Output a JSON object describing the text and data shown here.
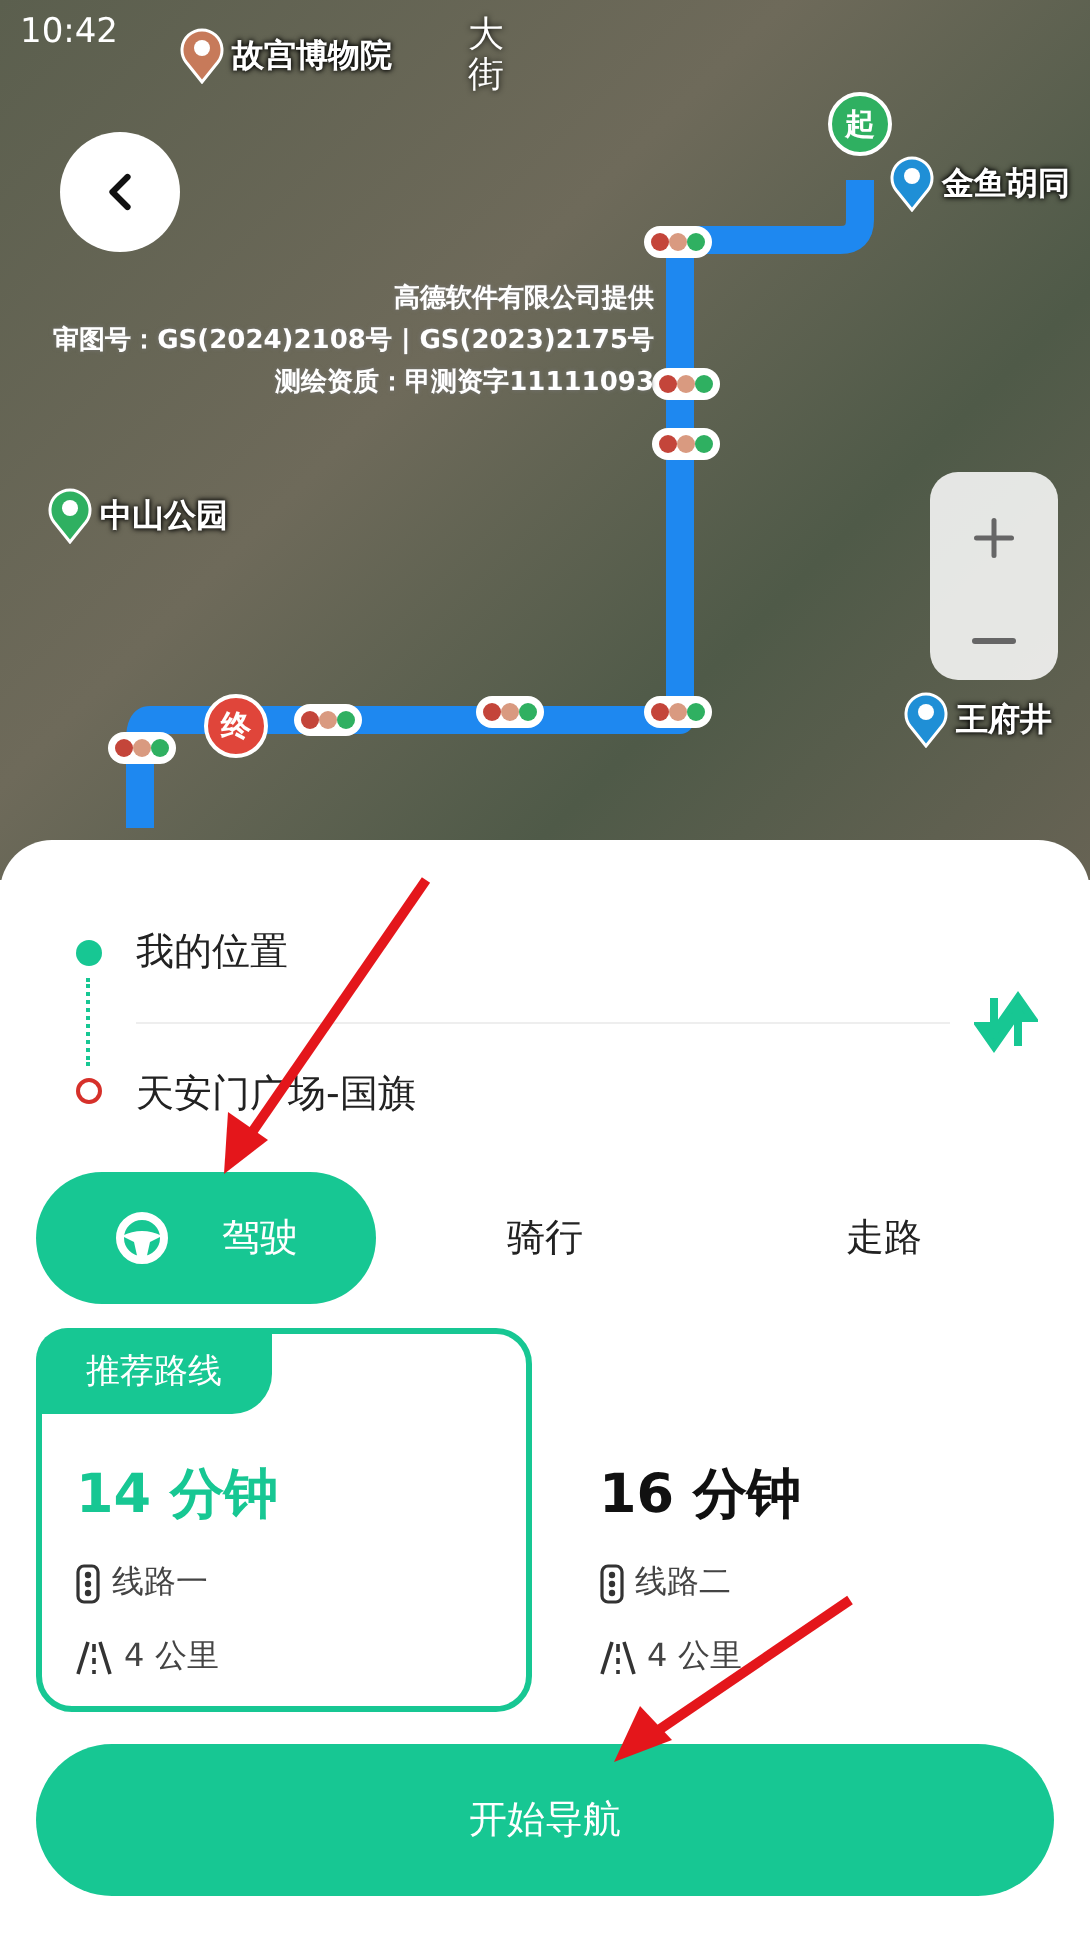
{
  "status_bar": {
    "time": "10:42"
  },
  "map": {
    "labels": [
      {
        "text": "故宫博物院",
        "kind": "poi"
      },
      {
        "text": "大街",
        "kind": "road"
      },
      {
        "text": "金鱼胡同",
        "kind": "metro"
      },
      {
        "text": "中山公园",
        "kind": "park"
      },
      {
        "text": "王府井",
        "kind": "metro"
      }
    ],
    "copyright": [
      "高德软件有限公司提供",
      "审图号：GS(2024)2108号 | GS(2023)2175号",
      "测绘资质：甲测资字11111093"
    ],
    "start_marker": "起",
    "end_marker": "终"
  },
  "route": {
    "origin": "我的位置",
    "destination": "天安门广场-国旗"
  },
  "modes": [
    {
      "label": "驾驶",
      "selected": true
    },
    {
      "label": "骑行",
      "selected": false
    },
    {
      "label": "走路",
      "selected": false
    }
  ],
  "routes": [
    {
      "tag": "推荐路线",
      "time": "14 分钟",
      "name": "线路一",
      "distance": "4 公里",
      "selected": true
    },
    {
      "time": "16 分钟",
      "name": "线路二",
      "distance": "4 公里",
      "selected": false
    }
  ],
  "start_button": "开始导航"
}
